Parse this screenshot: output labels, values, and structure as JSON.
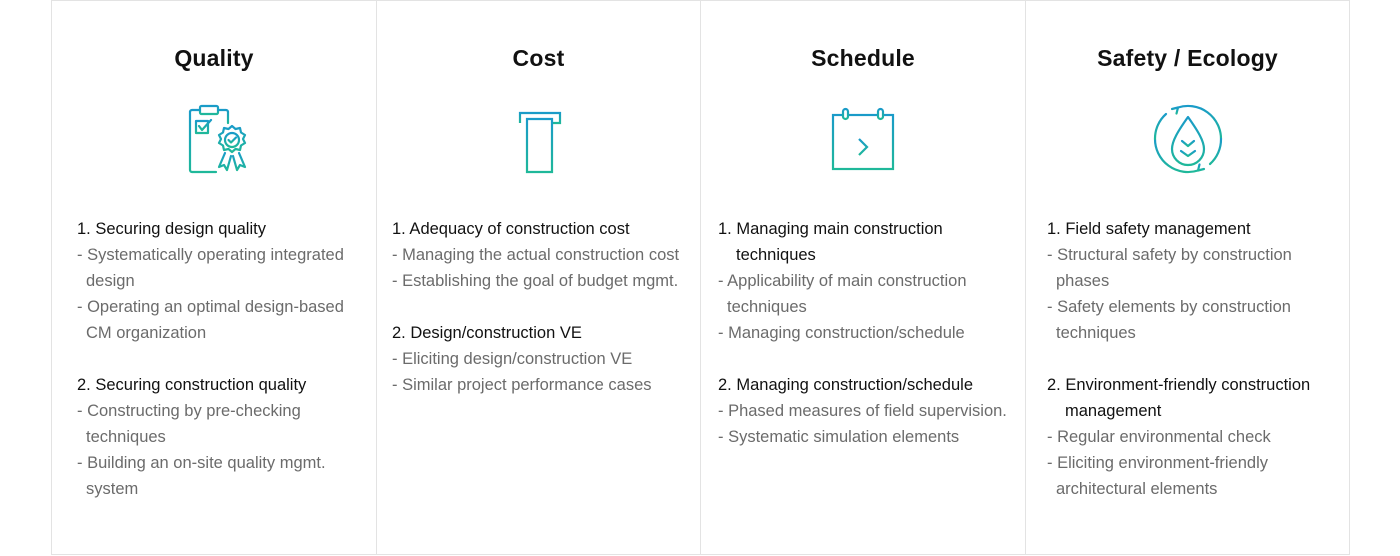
{
  "colors": {
    "icon_gradient_top": "#1a9bc9",
    "icon_gradient_bottom": "#1fb89a",
    "heading": "#111111",
    "item": "#6b6b6b",
    "border": "#e3e3e3"
  },
  "columns": [
    {
      "title": "Quality",
      "icon": "clipboard-award-icon",
      "sections": [
        {
          "heading": "1. Securing design quality",
          "items": [
            "- Systematically operating integrated design",
            "- Operating an optimal design-based CM organization"
          ]
        },
        {
          "heading": "2. Securing construction quality",
          "items": [
            "- Constructing by pre-checking techniques",
            "- Building an on-site quality mgmt. system"
          ]
        }
      ]
    },
    {
      "title": "Cost",
      "icon": "receipt-icon",
      "sections": [
        {
          "heading": "1. Adequacy of construction cost",
          "items": [
            "- Managing the actual construction cost",
            "- Establishing the goal of budget mgmt."
          ]
        },
        {
          "heading": "2. Design/construction VE",
          "items": [
            "- Eliciting design/construction VE",
            "- Similar project performance cases"
          ]
        }
      ]
    },
    {
      "title": "Schedule",
      "icon": "calendar-arrow-icon",
      "sections": [
        {
          "heading": "1. Managing main construction techniques",
          "items": [
            "- Applicability of main construction techniques",
            "- Managing construction/schedule"
          ]
        },
        {
          "heading": "2. Managing construction/schedule",
          "items": [
            "- Phased measures of field supervision.",
            "- Systematic simulation elements"
          ]
        }
      ]
    },
    {
      "title": "Safety / Ecology",
      "icon": "leaf-cycle-icon",
      "sections": [
        {
          "heading": "1. Field safety management",
          "items": [
            "- Structural safety by construction phases",
            "- Safety elements by construction techniques"
          ]
        },
        {
          "heading": "2. Environment-friendly construction management",
          "items": [
            "- Regular environmental check",
            "- Eliciting environment-friendly architectural elements"
          ]
        }
      ]
    }
  ]
}
